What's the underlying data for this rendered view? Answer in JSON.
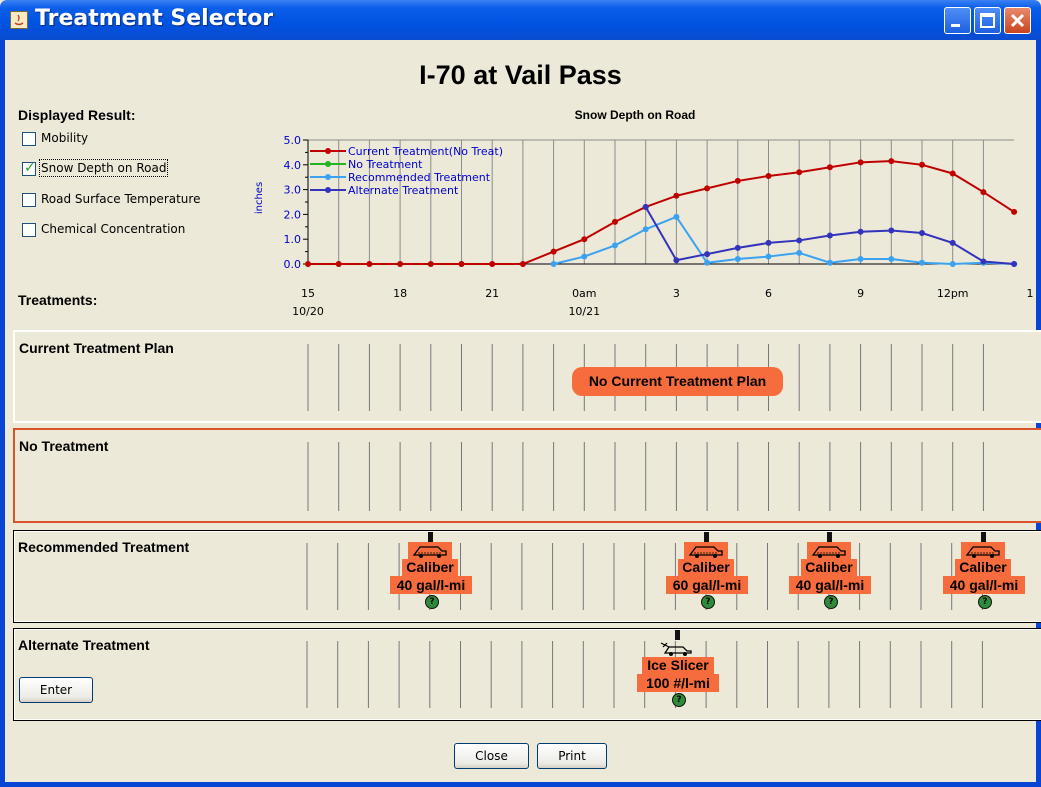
{
  "window": {
    "title": "Treatment Selector"
  },
  "location": "I-70 at Vail Pass",
  "displayed_result": {
    "heading": "Displayed Result:",
    "options": [
      {
        "label": "Mobility",
        "checked": false
      },
      {
        "label": "Snow Depth on Road",
        "checked": true
      },
      {
        "label": "Road Surface Temperature",
        "checked": false
      },
      {
        "label": "Chemical Concentration",
        "checked": false
      }
    ]
  },
  "treatments_heading": "Treatments:",
  "chart_data": {
    "type": "line",
    "title": "Snow Depth on Road",
    "ylabel": "inches",
    "xlabel": "",
    "ylim": [
      0,
      5
    ],
    "yticks": [
      "0.0",
      "1.0",
      "2.0",
      "3.0",
      "4.0",
      "5.0"
    ],
    "x_tick_labels": [
      "15",
      "18",
      "21",
      "0am",
      "3",
      "6",
      "9",
      "12pm",
      "1"
    ],
    "x_date_labels": [
      "10/20",
      "10/21"
    ],
    "x_hours": [
      15,
      16,
      17,
      18,
      19,
      20,
      21,
      22,
      23,
      24,
      25,
      26,
      27,
      28,
      29,
      30,
      31,
      32,
      33,
      34,
      35,
      36,
      37
    ],
    "series": [
      {
        "name": "Current Treatment(No Treat)",
        "color": "#c00000",
        "points": [
          [
            15,
            0
          ],
          [
            16,
            0
          ],
          [
            17,
            0
          ],
          [
            18,
            0
          ],
          [
            19,
            0
          ],
          [
            20,
            0
          ],
          [
            21,
            0
          ],
          [
            22,
            0
          ],
          [
            23,
            0.5
          ],
          [
            24,
            1.0
          ],
          [
            25,
            1.7
          ],
          [
            26,
            2.3
          ],
          [
            27,
            2.75
          ],
          [
            28,
            3.05
          ],
          [
            29,
            3.35
          ],
          [
            30,
            3.55
          ],
          [
            31,
            3.7
          ],
          [
            32,
            3.9
          ],
          [
            33,
            4.1
          ],
          [
            34,
            4.15
          ],
          [
            35,
            4.0
          ],
          [
            36,
            3.65
          ],
          [
            37,
            2.9
          ],
          [
            38,
            2.1
          ]
        ]
      },
      {
        "name": "No Treatment",
        "color": "#22b422",
        "points": []
      },
      {
        "name": "Recommended Treatment",
        "color": "#3aa2f0",
        "points": [
          [
            23,
            0
          ],
          [
            24,
            0.3
          ],
          [
            25,
            0.75
          ],
          [
            26,
            1.4
          ],
          [
            27,
            1.9
          ],
          [
            28,
            0.05
          ],
          [
            29,
            0.2
          ],
          [
            30,
            0.3
          ],
          [
            31,
            0.45
          ],
          [
            32,
            0.05
          ],
          [
            33,
            0.2
          ],
          [
            34,
            0.2
          ],
          [
            35,
            0.05
          ],
          [
            36,
            0
          ],
          [
            37,
            0.05
          ],
          [
            38,
            0
          ]
        ]
      },
      {
        "name": "Alternate Treatment",
        "color": "#3333bb",
        "points": [
          [
            26,
            2.3
          ],
          [
            27,
            0.15
          ],
          [
            28,
            0.4
          ],
          [
            29,
            0.65
          ],
          [
            30,
            0.85
          ],
          [
            31,
            0.95
          ],
          [
            32,
            1.15
          ],
          [
            33,
            1.3
          ],
          [
            34,
            1.35
          ],
          [
            35,
            1.25
          ],
          [
            36,
            0.85
          ],
          [
            37,
            0.1
          ],
          [
            38,
            0
          ]
        ]
      }
    ]
  },
  "panels": {
    "current": {
      "title": "Current Treatment Plan",
      "message": "No Current Treatment Plan"
    },
    "no_treatment": {
      "title": "No Treatment"
    },
    "recommended": {
      "title": "Recommended Treatment",
      "items": [
        {
          "name": "Caliber",
          "rate": "40 gal/l-mi",
          "help": "?"
        },
        {
          "name": "Caliber",
          "rate": "60 gal/l-mi",
          "help": "?"
        },
        {
          "name": "Caliber",
          "rate": "40 gal/l-mi",
          "help": "?"
        },
        {
          "name": "Caliber",
          "rate": "40 gal/l-mi",
          "help": "?"
        }
      ]
    },
    "alternate": {
      "title": "Alternate Treatment",
      "enter_label": "Enter",
      "items": [
        {
          "name": "Ice Slicer",
          "rate": "100 #/l-mi",
          "help": "?"
        }
      ]
    }
  },
  "buttons": {
    "close": "Close",
    "print": "Print"
  }
}
